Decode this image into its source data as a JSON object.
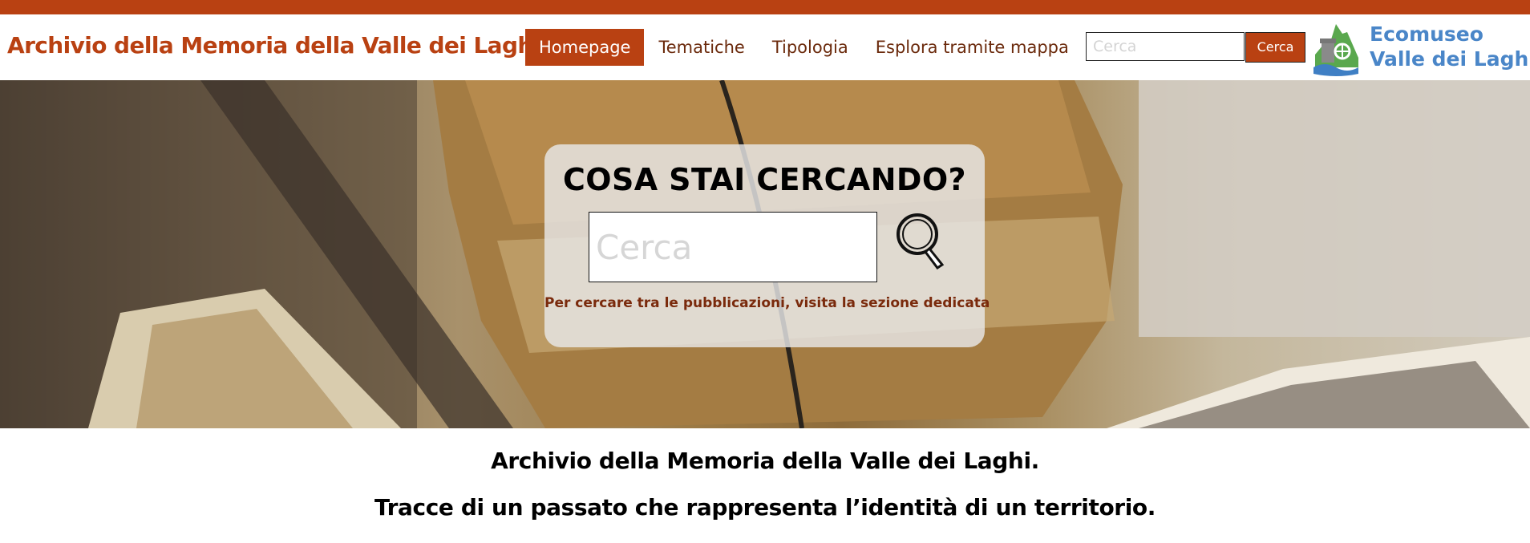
{
  "header": {
    "site_title": "Archivio della Memoria della Valle dei Laghi",
    "nav": [
      {
        "label": "Homepage",
        "active": true
      },
      {
        "label": "Tematiche",
        "active": false
      },
      {
        "label": "Tipologia",
        "active": false
      },
      {
        "label": "Esplora tramite mappa",
        "active": false
      }
    ],
    "search": {
      "placeholder": "Cerca",
      "value": "",
      "button_label": "Cerca"
    },
    "logo": {
      "line1": "Ecomuseo",
      "line2": "Valle dei Laghi",
      "icon": "ecomuseo-logo-icon"
    }
  },
  "hero": {
    "title": "COSA STAI CERCANDO?",
    "search": {
      "placeholder": "Cerca",
      "value": ""
    },
    "search_icon": "magnifying-glass-icon",
    "note": "Per cercare tra le pubblicazioni, visita la sezione dedicata"
  },
  "intro": {
    "line1": "Archivio della Memoria della Valle dei Laghi.",
    "line2": "Tracce di un passato che rappresenta l’identità di un territorio."
  },
  "colors": {
    "accent": "#b94112",
    "nav_text": "#6b2a0c",
    "logo_blue": "#4a86c8",
    "logo_green": "#5aa84e"
  }
}
